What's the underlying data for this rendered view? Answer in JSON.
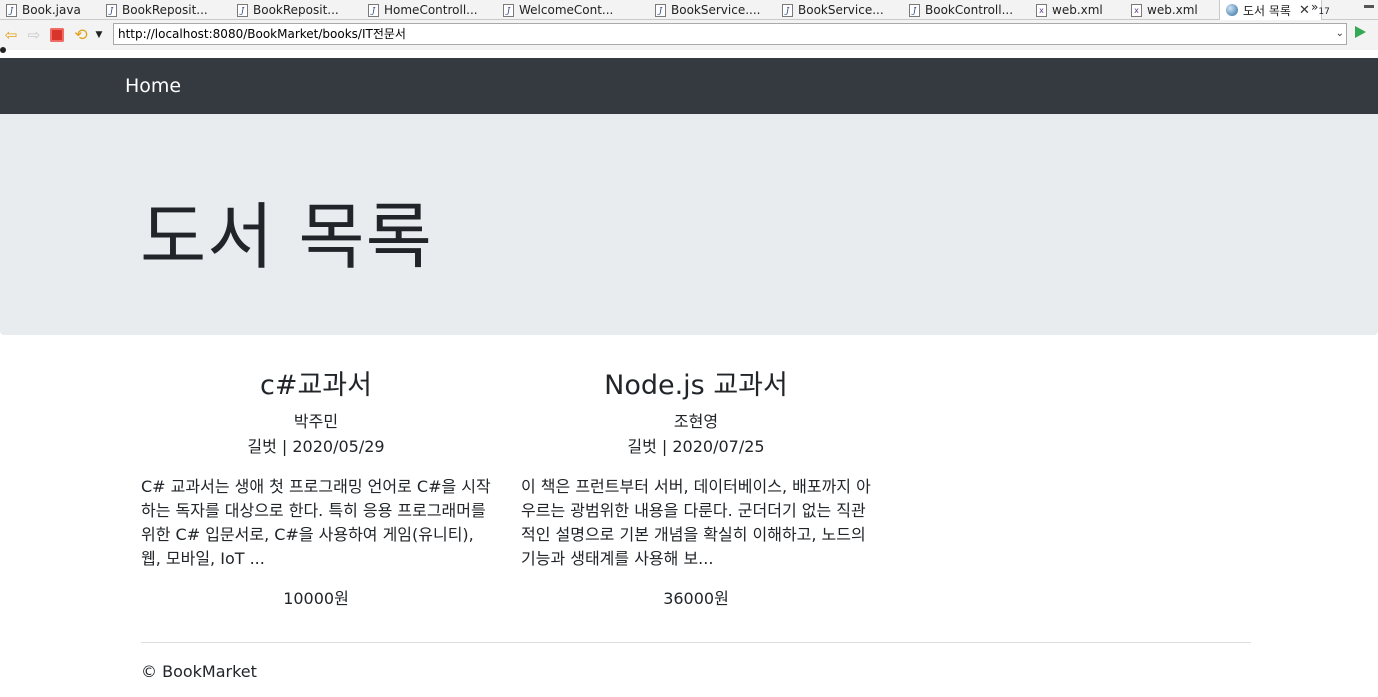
{
  "editor_tabs": [
    {
      "label": "Book.java",
      "icon": "java-file-icon"
    },
    {
      "label": "BookReposit...",
      "icon": "java-file-icon"
    },
    {
      "label": "BookReposit...",
      "icon": "java-file-icon"
    },
    {
      "label": "HomeControll...",
      "icon": "java-file-icon"
    },
    {
      "label": "WelcomeCont...",
      "icon": "java-file-icon"
    },
    {
      "label": "BookService....",
      "icon": "java-file-icon"
    },
    {
      "label": "BookService...",
      "icon": "java-file-icon"
    },
    {
      "label": "BookControll...",
      "icon": "java-file-icon"
    },
    {
      "label": "web.xml",
      "icon": "xml-file-icon"
    },
    {
      "label": "web.xml",
      "icon": "xml-file-icon"
    },
    {
      "label": "도서 목록",
      "icon": "globe-icon",
      "active": true
    }
  ],
  "tab_overflow": {
    "symbol": "»",
    "count": "17"
  },
  "browser": {
    "url": "http://localhost:8080/BookMarket/books/IT전문서"
  },
  "page": {
    "nav_brand": "Home",
    "jumbotron_title": "도서 목록",
    "books": [
      {
        "title": "c#교과서",
        "author": "박주민",
        "publisher_date": "길벗 | 2020/05/29",
        "description": "C# 교과서는 생애 첫 프로그래밍 언어로 C#을 시작하는 독자를 대상으로 한다. 특히 응용 프로그래머를 위한 C# 입문서로, C#을 사용하여 게임(유니티), 웹, 모바일, IoT ...",
        "price": "10000원"
      },
      {
        "title": "Node.js 교과서",
        "author": "조현영",
        "publisher_date": "길벗 | 2020/07/25",
        "description": "이 책은 프런트부터 서버, 데이터베이스, 배포까지 아우르는 광범위한 내용을 다룬다. 군더더기 없는 직관적인 설명으로 기본 개념을 확실히 이해하고, 노드의 기능과 생태계를 사용해 보...",
        "price": "36000원"
      }
    ],
    "footer": "© BookMarket"
  },
  "colors": {
    "navbar": "#343a40",
    "jumbotron": "#e9ecef",
    "text": "#212529"
  }
}
